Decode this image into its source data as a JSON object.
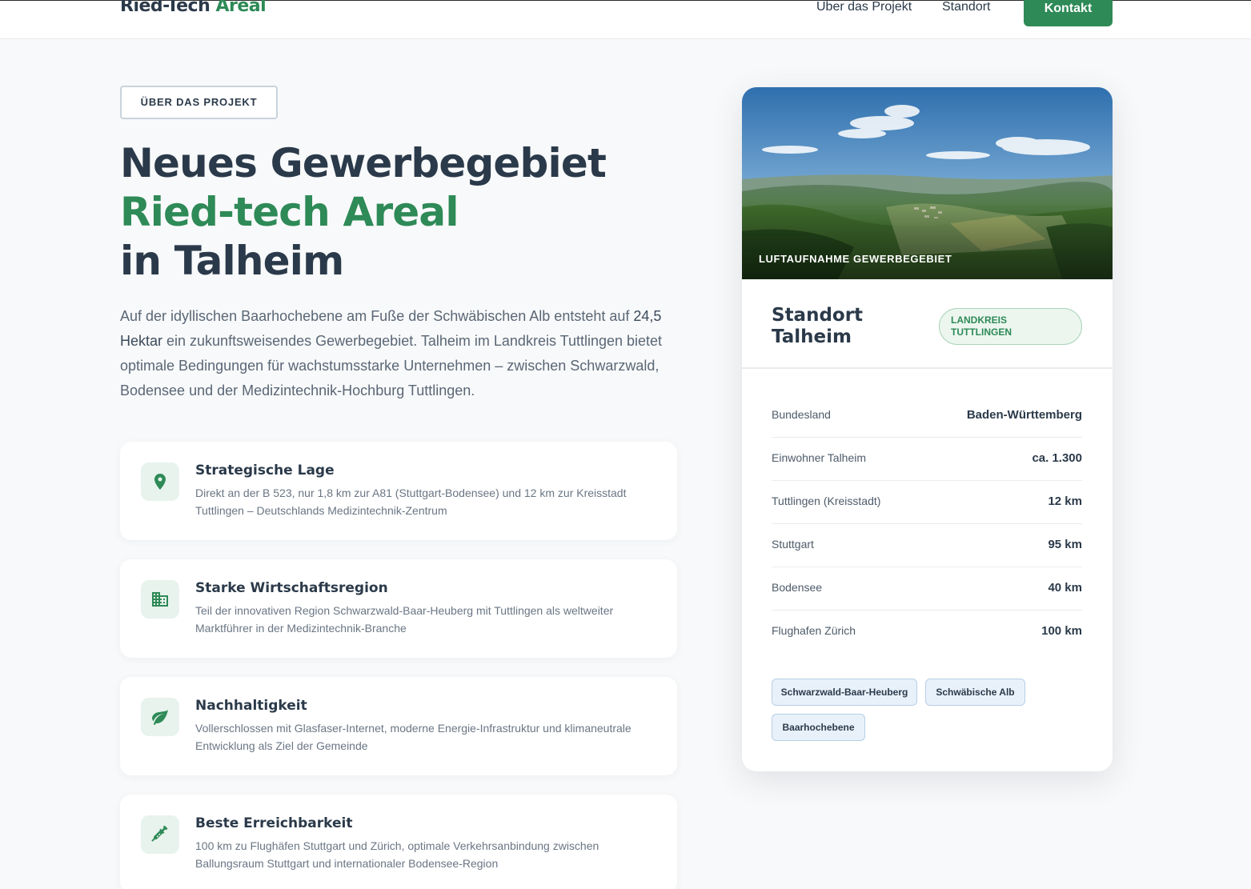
{
  "header": {
    "logo_main": "Ried-Tech",
    "logo_accent": "Areal",
    "nav": [
      {
        "label": "Über das Projekt"
      },
      {
        "label": "Standort"
      }
    ],
    "contact_label": "Kontakt"
  },
  "hero": {
    "badge": "ÜBER DAS PROJEKT",
    "headline_line1": "Neues Gewerbegebiet",
    "headline_line2": "Ried-tech Areal",
    "headline_line3": "in Talheim",
    "intro_part1": "Auf der idyllischen Baarhochebene am Fuße der Schwäbischen Alb entsteht auf ",
    "intro_strong": "24,5 Hektar",
    "intro_part2": " ein zukunftsweisendes Gewerbegebiet. Talheim im Landkreis Tuttlingen bietet optimale Bedingungen für wachstumsstarke Unternehmen – zwischen Schwarzwald, Bodensee und der Medizintechnik-Hochburg Tuttlingen."
  },
  "features": [
    {
      "icon": "location-pin-icon",
      "title": "Strategische Lage",
      "description": "Direkt an der B 523, nur 1,8 km zur A81 (Stuttgart-Bodensee) und 12 km zur Kreisstadt Tuttlingen – Deutschlands Medizintechnik-Zentrum"
    },
    {
      "icon": "building-icon",
      "title": "Starke Wirtschaftsregion",
      "description": "Teil der innovativen Region Schwarzwald-Baar-Heuberg mit Tuttlingen als weltweiter Marktführer in der Medizintechnik-Branche"
    },
    {
      "icon": "leaf-icon",
      "title": "Nachhaltigkeit",
      "description": "Vollerschlossen mit Glasfaser-Internet, moderne Energie-Infrastruktur und klimaneutrale Entwicklung als Ziel der Gemeinde"
    },
    {
      "icon": "syringe-icon",
      "title": "Beste Erreichbarkeit",
      "description": "100 km zu Flughäfen Stuttgart und Zürich, optimale Verkehrsanbindung zwischen Ballungsraum Stuttgart und internationaler Bodensee-Region"
    }
  ],
  "card": {
    "photo_caption": "LUFTAUFNAHME GEWERBEGEBIET",
    "title_line1": "Standort",
    "title_line2": "Talheim",
    "region_badge_line1": "LANDKREIS",
    "region_badge_line2": "TUTTLINGEN",
    "rows": [
      {
        "label": "Bundesland",
        "value": "Baden-Württemberg"
      },
      {
        "label": "Einwohner Talheim",
        "value": "ca. 1.300"
      },
      {
        "label": "Tuttlingen (Kreisstadt)",
        "value": "12 km"
      },
      {
        "label": "Stuttgart",
        "value": "95 km"
      },
      {
        "label": "Bodensee",
        "value": "40 km"
      },
      {
        "label": "Flughafen Zürich",
        "value": "100 km"
      }
    ],
    "tags": [
      "Schwarzwald-Baar-Heuberg",
      "Schwäbische Alb",
      "Baarhochebene"
    ]
  },
  "colors": {
    "accent_green": "#2e8a57",
    "text_dark": "#2b3a4a",
    "tag_blue_bg": "#e8f1fa"
  }
}
